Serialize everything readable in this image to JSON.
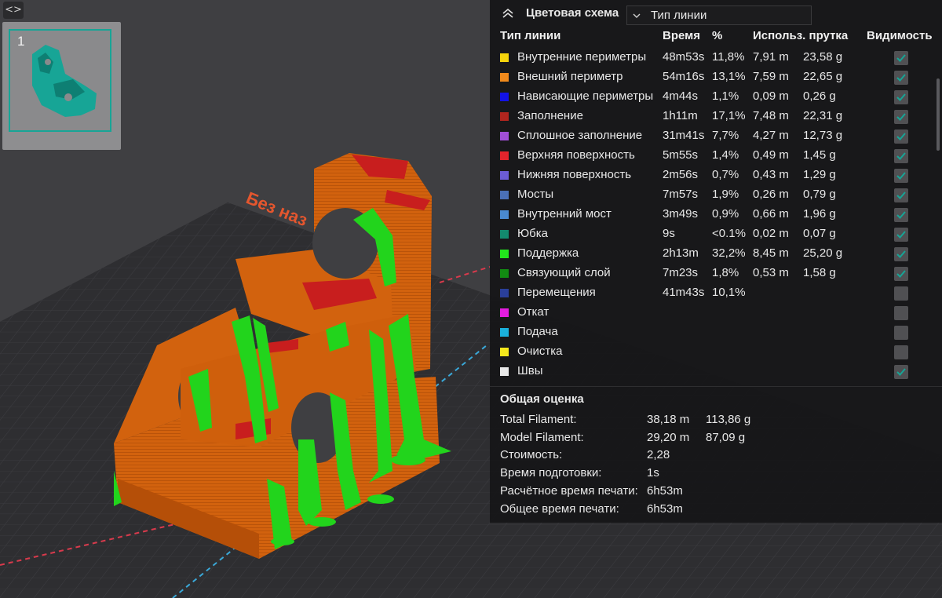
{
  "viewport": {
    "plate_label": "Без наз",
    "plate_number": "1",
    "colors": {
      "model": "#d2620e",
      "support": "#22d41c",
      "top_surface": "#c81e1e",
      "bed": "#2e2e31",
      "thumb_model": "#17a596"
    }
  },
  "collapse_button": "<>",
  "legend": {
    "scheme_title": "Цветовая схема",
    "scheme_value": "Тип линии",
    "columns": {
      "type": "Тип линии",
      "time": "Время",
      "percent": "%",
      "usage": "Использ. прутка",
      "visibility": "Видимость"
    },
    "rows": [
      {
        "name": "Внутренние периметры",
        "time": "48m53s",
        "percent": "11,8%",
        "length": "7,91 m",
        "weight": "23,58 g",
        "color": "#f5d40c",
        "visible": true
      },
      {
        "name": "Внешний периметр",
        "time": "54m16s",
        "percent": "13,1%",
        "length": "7,59 m",
        "weight": "22,65 g",
        "color": "#f08a1c",
        "visible": true
      },
      {
        "name": "Нависающие периметры",
        "time": "4m44s",
        "percent": "1,1%",
        "length": "0,09 m",
        "weight": "0,26 g",
        "color": "#1212e6",
        "visible": true
      },
      {
        "name": "Заполнение",
        "time": "1h11m",
        "percent": "17,1%",
        "length": "7,48 m",
        "weight": "22,31 g",
        "color": "#b0251e",
        "visible": true
      },
      {
        "name": "Сплошное заполнение",
        "time": "31m41s",
        "percent": "7,7%",
        "length": "4,27 m",
        "weight": "12,73 g",
        "color": "#a14fd6",
        "visible": true
      },
      {
        "name": "Верхняя поверхность",
        "time": "5m55s",
        "percent": "1,4%",
        "length": "0,49 m",
        "weight": "1,45 g",
        "color": "#e4242c",
        "visible": true
      },
      {
        "name": "Нижняя поверхность",
        "time": "2m56s",
        "percent": "0,7%",
        "length": "0,43 m",
        "weight": "1,29 g",
        "color": "#6b5cd6",
        "visible": true
      },
      {
        "name": "Мосты",
        "time": "7m57s",
        "percent": "1,9%",
        "length": "0,26 m",
        "weight": "0,79 g",
        "color": "#4a70b8",
        "visible": true
      },
      {
        "name": "Внутренний мост",
        "time": "3m49s",
        "percent": "0,9%",
        "length": "0,66 m",
        "weight": "1,96 g",
        "color": "#4a8ad0",
        "visible": true
      },
      {
        "name": "Юбка",
        "time": "9s",
        "percent": "<0.1%",
        "length": "0,02 m",
        "weight": "0,07 g",
        "color": "#138a6e",
        "visible": true
      },
      {
        "name": "Поддержка",
        "time": "2h13m",
        "percent": "32,2%",
        "length": "8,45 m",
        "weight": "25,20 g",
        "color": "#22e41c",
        "visible": true
      },
      {
        "name": "Связующий слой",
        "time": "7m23s",
        "percent": "1,8%",
        "length": "0,53 m",
        "weight": "1,58 g",
        "color": "#128a12",
        "visible": true
      },
      {
        "name": "Перемещения",
        "time": "41m43s",
        "percent": "10,1%",
        "length": "",
        "weight": "",
        "color": "#2a3f9a",
        "visible": false
      },
      {
        "name": "Откат",
        "time": "",
        "percent": "",
        "length": "",
        "weight": "",
        "color": "#e41ce0",
        "visible": false
      },
      {
        "name": "Подача",
        "time": "",
        "percent": "",
        "length": "",
        "weight": "",
        "color": "#1ab0dc",
        "visible": false
      },
      {
        "name": "Очистка",
        "time": "",
        "percent": "",
        "length": "",
        "weight": "",
        "color": "#f5e81c",
        "visible": false
      },
      {
        "name": "Швы",
        "time": "",
        "percent": "",
        "length": "",
        "weight": "",
        "color": "#e8e8e8",
        "visible": true
      }
    ],
    "summary_title": "Общая оценка",
    "summary": [
      {
        "label": "Total Filament:",
        "v1": "38,18 m",
        "v2": "113,86 g"
      },
      {
        "label": "Model Filament:",
        "v1": "29,20 m",
        "v2": "87,09 g"
      },
      {
        "label": "Стоимость:",
        "v1": "2,28",
        "v2": ""
      },
      {
        "label": "Время подготовки:",
        "v1": "1s",
        "v2": ""
      },
      {
        "label": "Расчётное время печати:",
        "v1": "6h53m",
        "v2": ""
      },
      {
        "label": "Общее время печати:",
        "v1": "6h53m",
        "v2": ""
      }
    ]
  }
}
